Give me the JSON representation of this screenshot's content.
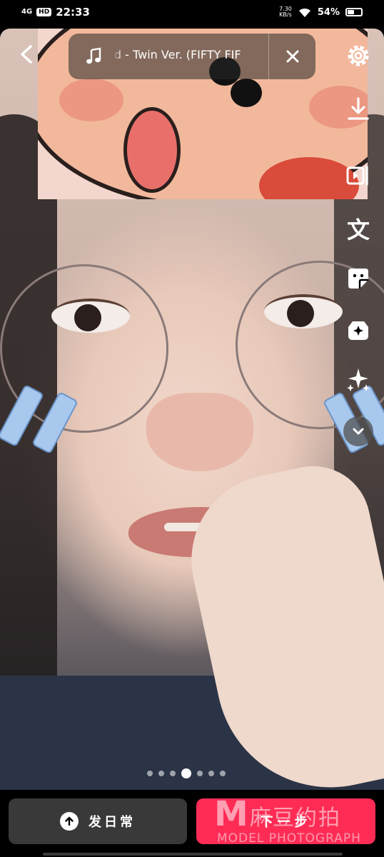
{
  "status_bar": {
    "network": "4G",
    "hd": "HD",
    "time": "22:33",
    "speed_value": "7.30",
    "speed_unit": "KB/s",
    "battery": "54%",
    "battery_level": 0.54
  },
  "music": {
    "title": "vid - Twin Ver. (FIFTY FIF"
  },
  "tools": {
    "text_label": "文",
    "icons": [
      "gear-icon",
      "download-icon",
      "video-clip-icon",
      "text-icon",
      "sticker-icon",
      "effect-icon",
      "sparkle-icon",
      "chevron-down-icon"
    ]
  },
  "pager": {
    "count": 7,
    "active_index": 3
  },
  "bottom": {
    "daily_label": "发日常",
    "next_label": "下一步"
  },
  "watermark": {
    "letter": "M",
    "cn": "麻豆约拍",
    "en": "MODEL PHOTOGRAPH"
  },
  "colors": {
    "accent": "#fe2c55",
    "secondary_button": "#393939"
  }
}
